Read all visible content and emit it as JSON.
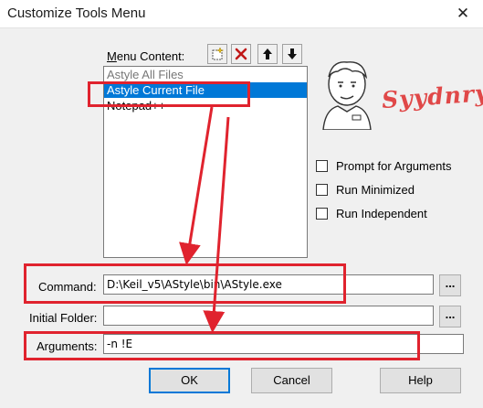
{
  "window": {
    "title": "Customize Tools Menu",
    "close_glyph": "✕"
  },
  "menu_content": {
    "label_accel": "M",
    "label_rest": "enu Content:",
    "toolbar": [
      {
        "name": "new-item-button",
        "icon": "new-icon"
      },
      {
        "name": "delete-item-button",
        "icon": "delete-icon"
      },
      {
        "name": "move-up-button",
        "icon": "arrow-up-icon"
      },
      {
        "name": "move-down-button",
        "icon": "arrow-down-icon"
      }
    ],
    "items": [
      {
        "label": "Astyle All Files",
        "selected": false
      },
      {
        "label": "Astyle Current File",
        "selected": true
      },
      {
        "label": "Notepad++",
        "selected": false
      }
    ]
  },
  "signature_text": "Syydnrycz",
  "options": {
    "prompt_for_arguments": {
      "label": "Prompt for  Arguments",
      "checked": false
    },
    "run_minimized": {
      "label": "Run Minimized",
      "checked": false
    },
    "run_independent": {
      "label": "Run Independent",
      "checked": false
    }
  },
  "fields": {
    "command": {
      "label": "Command:",
      "value": "D:\\Keil_v5\\AStyle\\bin\\AStyle.exe"
    },
    "initial_folder": {
      "label": "Initial Folder:",
      "value": ""
    },
    "arguments": {
      "label": "Arguments:",
      "value": "-n !E"
    },
    "browse_label": "..."
  },
  "buttons": {
    "ok": "OK",
    "cancel": "Cancel",
    "help": "Help"
  },
  "colors": {
    "annotation": "#e0232e",
    "selection": "#0078d7"
  }
}
